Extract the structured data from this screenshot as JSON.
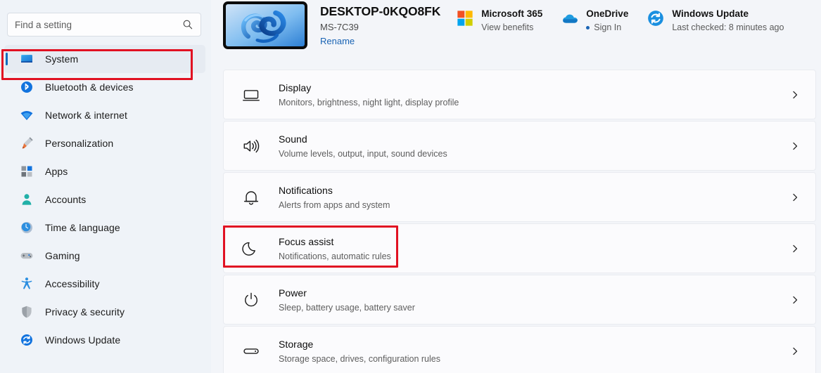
{
  "search": {
    "placeholder": "Find a setting",
    "value": "",
    "icon": "search-icon"
  },
  "sidebar": {
    "items": [
      {
        "label": "System",
        "icon": "system-icon",
        "selected": true
      },
      {
        "label": "Bluetooth & devices",
        "icon": "bluetooth-icon",
        "selected": false
      },
      {
        "label": "Network & internet",
        "icon": "wifi-icon",
        "selected": false
      },
      {
        "label": "Personalization",
        "icon": "paintbrush-icon",
        "selected": false
      },
      {
        "label": "Apps",
        "icon": "apps-icon",
        "selected": false
      },
      {
        "label": "Accounts",
        "icon": "person-icon",
        "selected": false
      },
      {
        "label": "Time & language",
        "icon": "clock-icon",
        "selected": false
      },
      {
        "label": "Gaming",
        "icon": "gamepad-icon",
        "selected": false
      },
      {
        "label": "Accessibility",
        "icon": "accessibility-icon",
        "selected": false
      },
      {
        "label": "Privacy & security",
        "icon": "shield-icon",
        "selected": false
      },
      {
        "label": "Windows Update",
        "icon": "update-icon",
        "selected": false
      }
    ]
  },
  "device": {
    "name": "DESKTOP-0KQO8FK",
    "model": "MS-7C39",
    "rename_label": "Rename",
    "thumbnail": "windows-11-bloom-wallpaper"
  },
  "header_cards": [
    {
      "title": "Microsoft 365",
      "subtitle": "View benefits",
      "icon": "microsoft-365-icon",
      "has_dot": false
    },
    {
      "title": "OneDrive",
      "subtitle": "Sign In",
      "icon": "onedrive-icon",
      "has_dot": true
    },
    {
      "title": "Windows Update",
      "subtitle": "Last checked: 8 minutes ago",
      "icon": "windows-update-icon",
      "has_dot": false
    }
  ],
  "settings_cards": [
    {
      "title": "Display",
      "subtitle": "Monitors, brightness, night light, display profile",
      "icon": "monitor-icon",
      "highlighted": false
    },
    {
      "title": "Sound",
      "subtitle": "Volume levels, output, input, sound devices",
      "icon": "speaker-icon",
      "highlighted": false
    },
    {
      "title": "Notifications",
      "subtitle": "Alerts from apps and system",
      "icon": "bell-icon",
      "highlighted": false
    },
    {
      "title": "Focus assist",
      "subtitle": "Notifications, automatic rules",
      "icon": "moon-icon",
      "highlighted": true
    },
    {
      "title": "Power",
      "subtitle": "Sleep, battery usage, battery saver",
      "icon": "power-icon",
      "highlighted": false
    },
    {
      "title": "Storage",
      "subtitle": "Storage space, drives, configuration rules",
      "icon": "drive-icon",
      "highlighted": false
    }
  ],
  "colors": {
    "accent": "#0f6cbd",
    "highlight_box": "#e11122",
    "sidebar_bg": "#eff3f8",
    "content_bg": "#f3f5f9",
    "card_bg": "#fbfbfd",
    "link": "#1a64b4"
  },
  "chevron_icon": "chevron-right-icon"
}
